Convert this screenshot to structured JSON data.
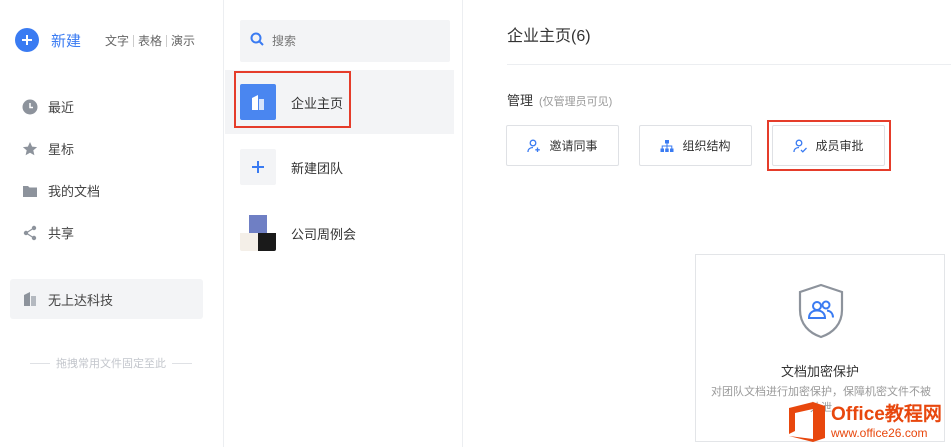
{
  "sidebar": {
    "new_label": "新建",
    "quick": [
      "文字",
      "表格",
      "演示"
    ],
    "nav": [
      {
        "label": "最近",
        "icon": "clock-icon"
      },
      {
        "label": "星标",
        "icon": "star-icon"
      },
      {
        "label": "我的文档",
        "icon": "folder-icon"
      },
      {
        "label": "共享",
        "icon": "share-icon"
      }
    ],
    "team_label": "无上达科技",
    "pin_hint": "拖拽常用文件固定至此"
  },
  "middle": {
    "search_placeholder": "搜索",
    "items": [
      {
        "label": "企业主页"
      },
      {
        "label": "新建团队"
      },
      {
        "label": "公司周例会"
      }
    ]
  },
  "content": {
    "title": "企业主页(6)",
    "manage_label": "管理",
    "manage_note": "(仅管理员可见)",
    "buttons": [
      {
        "label": "邀请同事"
      },
      {
        "label": "组织结构"
      },
      {
        "label": "成员审批"
      }
    ],
    "card_title": "文档加密保护",
    "card_desc": "对团队文档进行加密保护，保障机密文件不被外泄"
  },
  "watermark": {
    "big": "Office教程网",
    "small": "www.office26.com"
  },
  "colors": {
    "accent": "#3a7bf2",
    "highlight": "#e53c2a"
  }
}
